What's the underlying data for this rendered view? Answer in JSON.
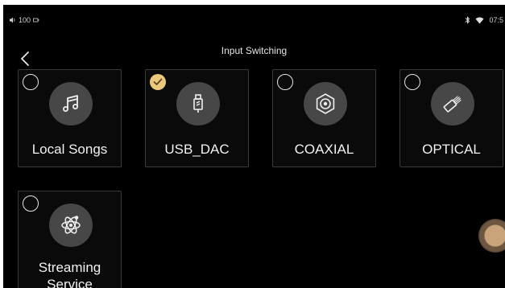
{
  "status": {
    "volume": "100",
    "time": "07:5"
  },
  "header": {
    "title": "Input Switching"
  },
  "inputs": [
    {
      "label": "Local Songs",
      "selected": false,
      "icon": "music-note-icon"
    },
    {
      "label": "USB_DAC",
      "selected": true,
      "icon": "usb-plug-icon"
    },
    {
      "label": "COAXIAL",
      "selected": false,
      "icon": "coaxial-connector-icon"
    },
    {
      "label": "OPTICAL",
      "selected": false,
      "icon": "optical-cable-icon"
    },
    {
      "label": "Streaming Service",
      "selected": false,
      "icon": "atom-icon"
    }
  ],
  "colors": {
    "background": "#000000",
    "card_border": "#3a3a3a",
    "icon_circle": "#474747",
    "selected_accent": "#ecc87a"
  }
}
